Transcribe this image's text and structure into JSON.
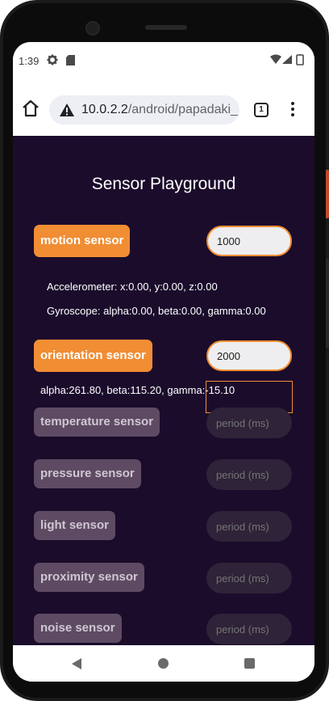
{
  "status_bar": {
    "time": "1:39"
  },
  "browser": {
    "url_host": "10.0.2.2",
    "url_path": "/android/papadaki_",
    "tab_count": "1"
  },
  "page": {
    "title": "Sensor Playground",
    "motion": {
      "label": "motion sensor",
      "period_value": "1000",
      "accelerometer": "Accelerometer: x:0.00, y:0.00, z:0.00",
      "gyroscope": "Gyroscope: alpha:0.00, beta:0.00, gamma:0.00"
    },
    "orientation": {
      "label": "orientation sensor",
      "period_value": "2000",
      "reading": "alpha:261.80, beta:115.20, gamma:-15.10"
    },
    "disabled_sensors": [
      {
        "label": "temperature sensor",
        "placeholder": "period (ms)"
      },
      {
        "label": "pressure sensor",
        "placeholder": "period (ms)"
      },
      {
        "label": "light sensor",
        "placeholder": "period (ms)"
      },
      {
        "label": "proximity sensor",
        "placeholder": "period (ms)"
      },
      {
        "label": "noise sensor",
        "placeholder": "period (ms)"
      }
    ]
  },
  "colors": {
    "page_background": "#1b0c2c",
    "accent": "#f18d33",
    "disabled": "#5e4b63"
  }
}
